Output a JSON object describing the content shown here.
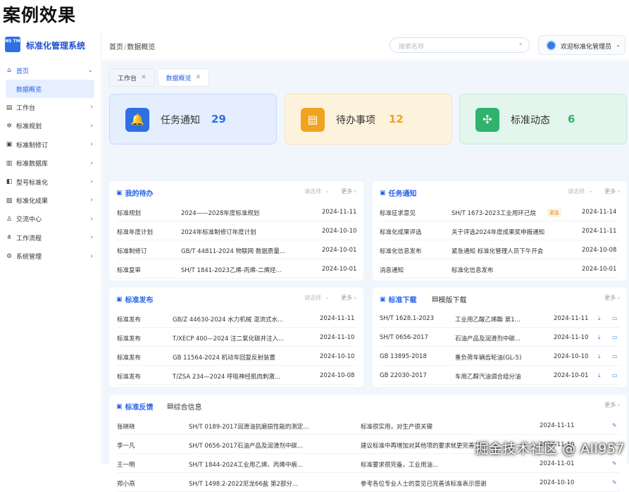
{
  "page_title": "案例效果",
  "sidebar": {
    "logo_text": "NS TM",
    "brand": "标准化管理系统",
    "items": [
      {
        "label": "首页",
        "icon": "home-icon",
        "glyph": "⌂",
        "open": true,
        "children": [
          "数据概览"
        ]
      },
      {
        "label": "工作台",
        "icon": "workbench-icon",
        "glyph": "▤"
      },
      {
        "label": "标准规划",
        "icon": "gear-icon",
        "glyph": "✲"
      },
      {
        "label": "标准制修订",
        "icon": "edit-doc-icon",
        "glyph": "▣"
      },
      {
        "label": "标准数据库",
        "icon": "database-icon",
        "glyph": "▥"
      },
      {
        "label": "型号标准化",
        "icon": "model-icon",
        "glyph": "◧"
      },
      {
        "label": "标准化成果",
        "icon": "achievement-icon",
        "glyph": "▧"
      },
      {
        "label": "交流中心",
        "icon": "people-icon",
        "glyph": "♙"
      },
      {
        "label": "工作流程",
        "icon": "flow-icon",
        "glyph": "⋔"
      },
      {
        "label": "系统管理",
        "icon": "settings-icon",
        "glyph": "⚙"
      }
    ]
  },
  "header": {
    "breadcrumb": [
      "首页",
      "数据概览"
    ],
    "search_placeholder": "搜索名称",
    "user_name": "欢迎标准化管理员"
  },
  "tabs": [
    {
      "label": "工作台",
      "active": false
    },
    {
      "label": "数据概览",
      "active": true
    }
  ],
  "stats": [
    {
      "label": "任务通知",
      "value": "29",
      "icon": "bell-icon",
      "glyph": "🔔",
      "color": "#2f6fe4",
      "bg": "#e4eeff",
      "border": "#c6d9fb"
    },
    {
      "label": "待办事项",
      "value": "12",
      "icon": "todo-icon",
      "glyph": "▤",
      "color": "#f0a31f",
      "bg": "#fdf3dd",
      "border": "#f6e2b4"
    },
    {
      "label": "标准动态",
      "value": "6",
      "icon": "pinwheel-icon",
      "glyph": "✣",
      "color": "#2fb36b",
      "bg": "#e3f6ed",
      "border": "#c4ebd6"
    }
  ],
  "todo": {
    "title": "我的待办",
    "select": "请选择",
    "more": "更多",
    "rows": [
      [
        "标准规划",
        "2024——2028年度标准规划",
        "2024-11-11"
      ],
      [
        "标准年度计划",
        "2024年标准制修订年度计划",
        "2024-10-10"
      ],
      [
        "标准制修订",
        "GB/T 44811-2024 物联网 数据质量...",
        "2024-10-01"
      ],
      [
        "标准复审",
        "SH/T 1841-2023乙烯-丙烯-二烯烃...",
        "2024-10-01"
      ]
    ]
  },
  "notice": {
    "title": "任务通知",
    "select": "请选择",
    "more": "更多",
    "rows": [
      [
        "标准征求意见",
        "SH/T 1673-2023工业用环己烷",
        "紧急",
        "2024-11-14"
      ],
      [
        "标准化成果评选",
        "关于评选2024年度成果奖申报通知",
        "",
        "2024-11-11"
      ],
      [
        "标准化信息发布",
        "紧急通知 标准化管理人员下午开会",
        "",
        "2024-10-08"
      ],
      [
        "消息通知",
        "标准化信息发布",
        "",
        "2024-10-01"
      ]
    ]
  },
  "publish": {
    "title": "标准发布",
    "select": "请选择",
    "more": "更多",
    "rows": [
      [
        "标准发布",
        "GB/Z 44630-2024 水力机械 混流式水...",
        "2024-11-11"
      ],
      [
        "标准发布",
        "T/XECP 400—2024 注二氧化碳井注入...",
        "2024-11-10"
      ],
      [
        "标准发布",
        "GB 11564-2024 机动车回复反射装置",
        "2024-10-10"
      ],
      [
        "标准发布",
        "T/ZSA 234—2024 呼吸神经肌肉刺激...",
        "2024-10-08"
      ]
    ]
  },
  "download": {
    "title": "标准下载",
    "title2": "模版下载",
    "more": "更多",
    "rows": [
      [
        "SH/T 1628.1-2023",
        "工业用乙酸乙烯酯 第1...",
        "2024-11-11"
      ],
      [
        "SH/T 0656-2017",
        "石油产品及润滑剂中碳...",
        "2024-11-10"
      ],
      [
        "GB 13895-2018",
        "重负荷车辆齿轮油(GL-5)",
        "2024-10-10"
      ],
      [
        "GB 22030-2017",
        "车用乙醇汽油调合组分油",
        "2024-10-01"
      ]
    ]
  },
  "feedback": {
    "title": "标准反馈",
    "title2": "综合信息",
    "more": "更多",
    "rows": [
      [
        "张晓晓",
        "SH/T 0189-2017润滑油抗磨损性能的测定...",
        "标准很实用，对生产很关键",
        "2024-11-11"
      ],
      [
        "李一凡",
        "SH/T 0656-2017石油产品及润滑剂中碳...",
        "建议标准中再增加对其他项的要求就更完善了",
        "2024-11-10"
      ],
      [
        "王一明",
        "SH/T 1844-2024工业用乙烯、丙烯中痕...",
        "标准要求很完备，工业用油...",
        "2024-11-01"
      ],
      [
        "郑小燕",
        "SH/T 1498.2-2022尼龙66盐 第2部分...",
        "参考各位专业人士的意见已完善该标准表示感谢",
        "2024-10-10"
      ]
    ]
  },
  "watermark": "掘金技术社区 @ All957"
}
